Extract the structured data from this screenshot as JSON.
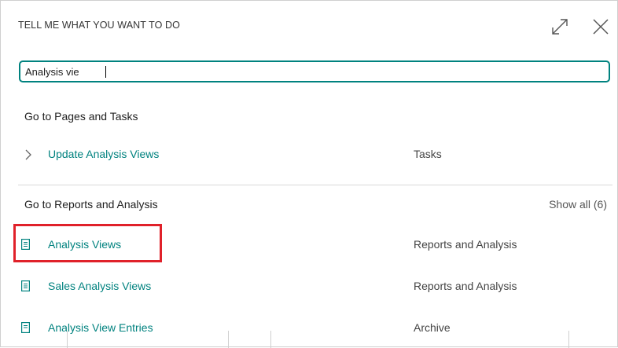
{
  "dialog": {
    "title": "TELL ME WHAT YOU WANT TO DO"
  },
  "search": {
    "value": "Analysis vie"
  },
  "sections": [
    {
      "heading": "Go to Pages and Tasks",
      "items": [
        {
          "label": "Update Analysis Views",
          "category": "Tasks",
          "icon": "chevron-right-icon"
        }
      ]
    },
    {
      "heading": "Go to Reports and Analysis",
      "show_all": "Show all (6)",
      "items": [
        {
          "label": "Analysis Views",
          "category": "Reports and Analysis",
          "icon": "report-icon"
        },
        {
          "label": "Sales Analysis Views",
          "category": "Reports and Analysis",
          "icon": "report-icon"
        },
        {
          "label": "Analysis View Entries",
          "category": "Archive",
          "icon": "report-icon"
        }
      ]
    }
  ],
  "colors": {
    "accent": "#00827f",
    "highlight": "#e0212a"
  }
}
